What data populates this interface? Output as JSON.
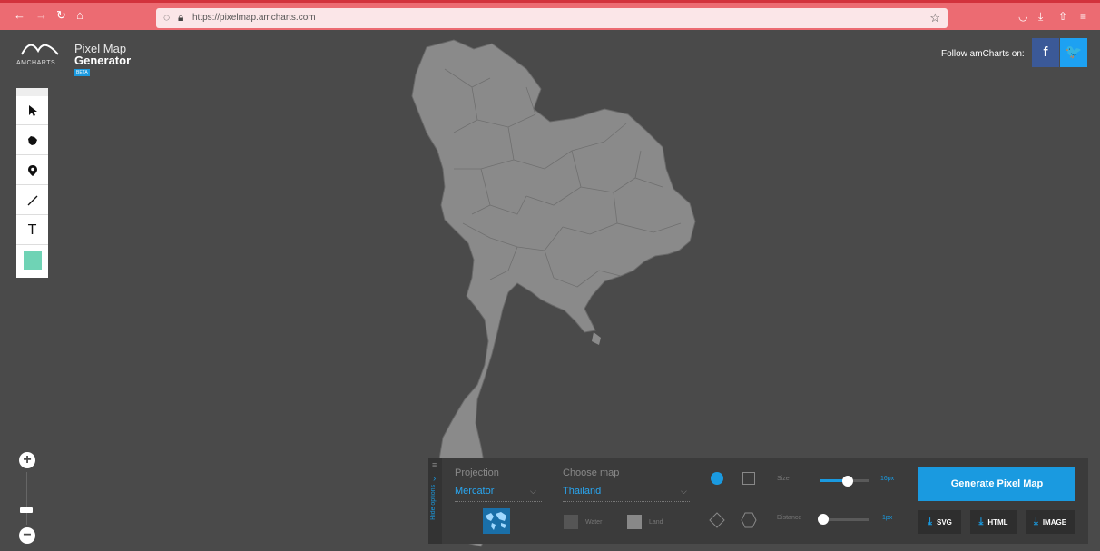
{
  "browser": {
    "url": "https://pixelmap.amcharts.com",
    "icons": [
      "back-icon",
      "forward-icon",
      "reload-icon",
      "home-icon",
      "shield-icon",
      "lock-icon",
      "star-icon",
      "pocket-icon",
      "download-icon",
      "extensions-icon",
      "menu-icon"
    ]
  },
  "header": {
    "brand": "AMCHARTS",
    "title_line1": "Pixel Map",
    "title_line2": "Generator",
    "beta": "BETA",
    "follow_text": "Follow amCharts on:",
    "facebook_label": "f",
    "twitter_label": "🐦"
  },
  "toolbar": {
    "tools": [
      "pointer-tool",
      "region-tool",
      "marker-tool",
      "line-tool",
      "text-tool",
      "color-swatch"
    ],
    "text_tool_label": "T",
    "selected_color": "#6fd3b5"
  },
  "zoom": {
    "plus": "+",
    "minus": "−"
  },
  "panel": {
    "hide_options": "Hide options",
    "projection_label": "Projection",
    "projection_value": "Mercator",
    "map_label": "Choose map",
    "map_value": "Thailand",
    "water_label": "Water",
    "land_label": "Land",
    "size_label": "Size",
    "size_value": "16px",
    "size_level": 0.55,
    "distance_label": "Distance",
    "distance_value": "1px",
    "distance_level": 0.05,
    "generate_label": "Generate Pixel Map",
    "svg_label": "SVG",
    "html_label": "HTML",
    "image_label": "IMAGE",
    "accent_color": "#1a9ae0"
  }
}
